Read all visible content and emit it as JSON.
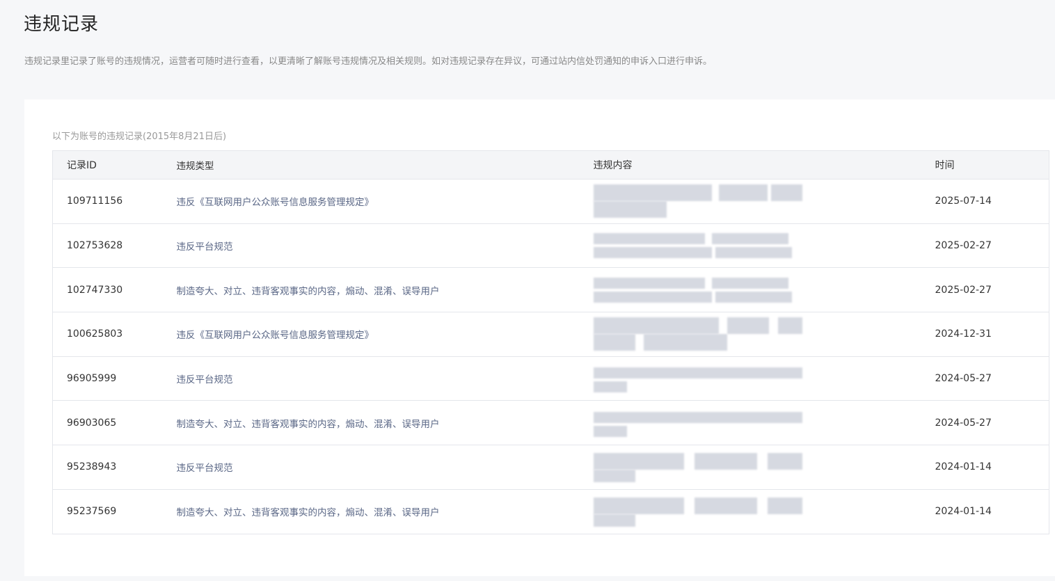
{
  "header": {
    "title": "违规记录",
    "description": "违规记录里记录了账号的违规情况，运营者可随时进行查看，以更清晰了解账号违规情况及相关规则。如对违规记录存在异议，可通过站内信处罚通知的申诉入口进行申诉。"
  },
  "table": {
    "caption": "以下为账号的违规记录(2015年8月21日后)",
    "columns": [
      "记录ID",
      "违规类型",
      "违规内容",
      "时间"
    ],
    "rows": [
      {
        "id": "109711156",
        "type": "违反《互联网用户公众账号信息服务管理规定》",
        "time": "2025-07-14"
      },
      {
        "id": "102753628",
        "type": "违反平台规范",
        "time": "2025-02-27"
      },
      {
        "id": "102747330",
        "type": "制造夸大、对立、违背客观事实的内容，煽动、混淆、误导用户",
        "time": "2025-02-27"
      },
      {
        "id": "100625803",
        "type": "违反《互联网用户公众账号信息服务管理规定》",
        "time": "2024-12-31"
      },
      {
        "id": "96905999",
        "type": "违反平台规范",
        "time": "2024-05-27"
      },
      {
        "id": "96903065",
        "type": "制造夸大、对立、违背客观事实的内容，煽动、混淆、误导用户",
        "time": "2024-05-27"
      },
      {
        "id": "95238943",
        "type": "违反平台规范",
        "time": "2024-01-14"
      },
      {
        "id": "95237569",
        "type": "制造夸大、对立、违背客观事实的内容，煽动、混淆、误导用户",
        "time": "2024-01-14"
      }
    ]
  }
}
